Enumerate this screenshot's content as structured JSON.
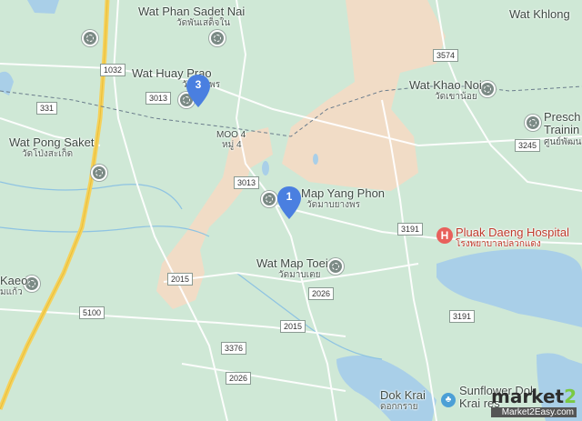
{
  "colors": {
    "land": "#cfe8d6",
    "urban": "#f1dcc6",
    "water": "#a9cfe8",
    "road": "#ffffff",
    "highway": "#f5d15b",
    "pin": "#4a7fe0"
  },
  "places": {
    "wat_phan_sadet_nai": {
      "name": "Wat Phan Sadet Nai",
      "sub": "วัดพันเสด็จใน"
    },
    "wat_huay_prao": {
      "name": "Wat Huay Prao",
      "sub": "วัดห้วยพร"
    },
    "wat_pong_saket": {
      "name": "Wat Pong Saket",
      "sub": "วัดโป่งสะเก็ด"
    },
    "moo4": {
      "name": "MOO 4",
      "sub": "หมู่ 4"
    },
    "wat_map_yang_phon": {
      "name": "Map Yang Phon",
      "sub": "วัดมาบยางพร"
    },
    "wat_map_toei": {
      "name": "Wat Map Toei",
      "sub": "วัดมาบเตย"
    },
    "wat_khao_noi": {
      "name": "Wat Khao Noi",
      "sub": "วัดเขาน้อย"
    },
    "wat_khlong": {
      "name": "Wat Khlong"
    },
    "preschool": {
      "name": "Presch",
      "line2": "Trainin",
      "sub": "ศูนย์พัฒนาเด็ก"
    },
    "pluak_daeng_hospital": {
      "name": "Pluak Daeng Hospital",
      "sub": "โรงพยาบาลปลวกแดง"
    },
    "kaeo": {
      "name": "Kaeo",
      "sub": "มแก้ว"
    },
    "dok_krai": {
      "name": "Dok Krai",
      "sub": "ดอกกราย"
    },
    "sunflower": {
      "name": "Sunflower Dok",
      "line2": "Krai res"
    }
  },
  "roads": [
    "1032",
    "3013",
    "331",
    "3574",
    "3245",
    "3191",
    "2015",
    "5100",
    "3376",
    "2026",
    "3013",
    "3191",
    "2026"
  ],
  "pins": [
    {
      "label": "3"
    },
    {
      "label": "1"
    }
  ],
  "icons": {
    "poi": "temple-icon",
    "pin": "map-pin-icon",
    "hospital": "hospital-icon"
  },
  "brand": {
    "name_a": "market",
    "name_b": "2",
    "url": "Market2Easy.com"
  }
}
